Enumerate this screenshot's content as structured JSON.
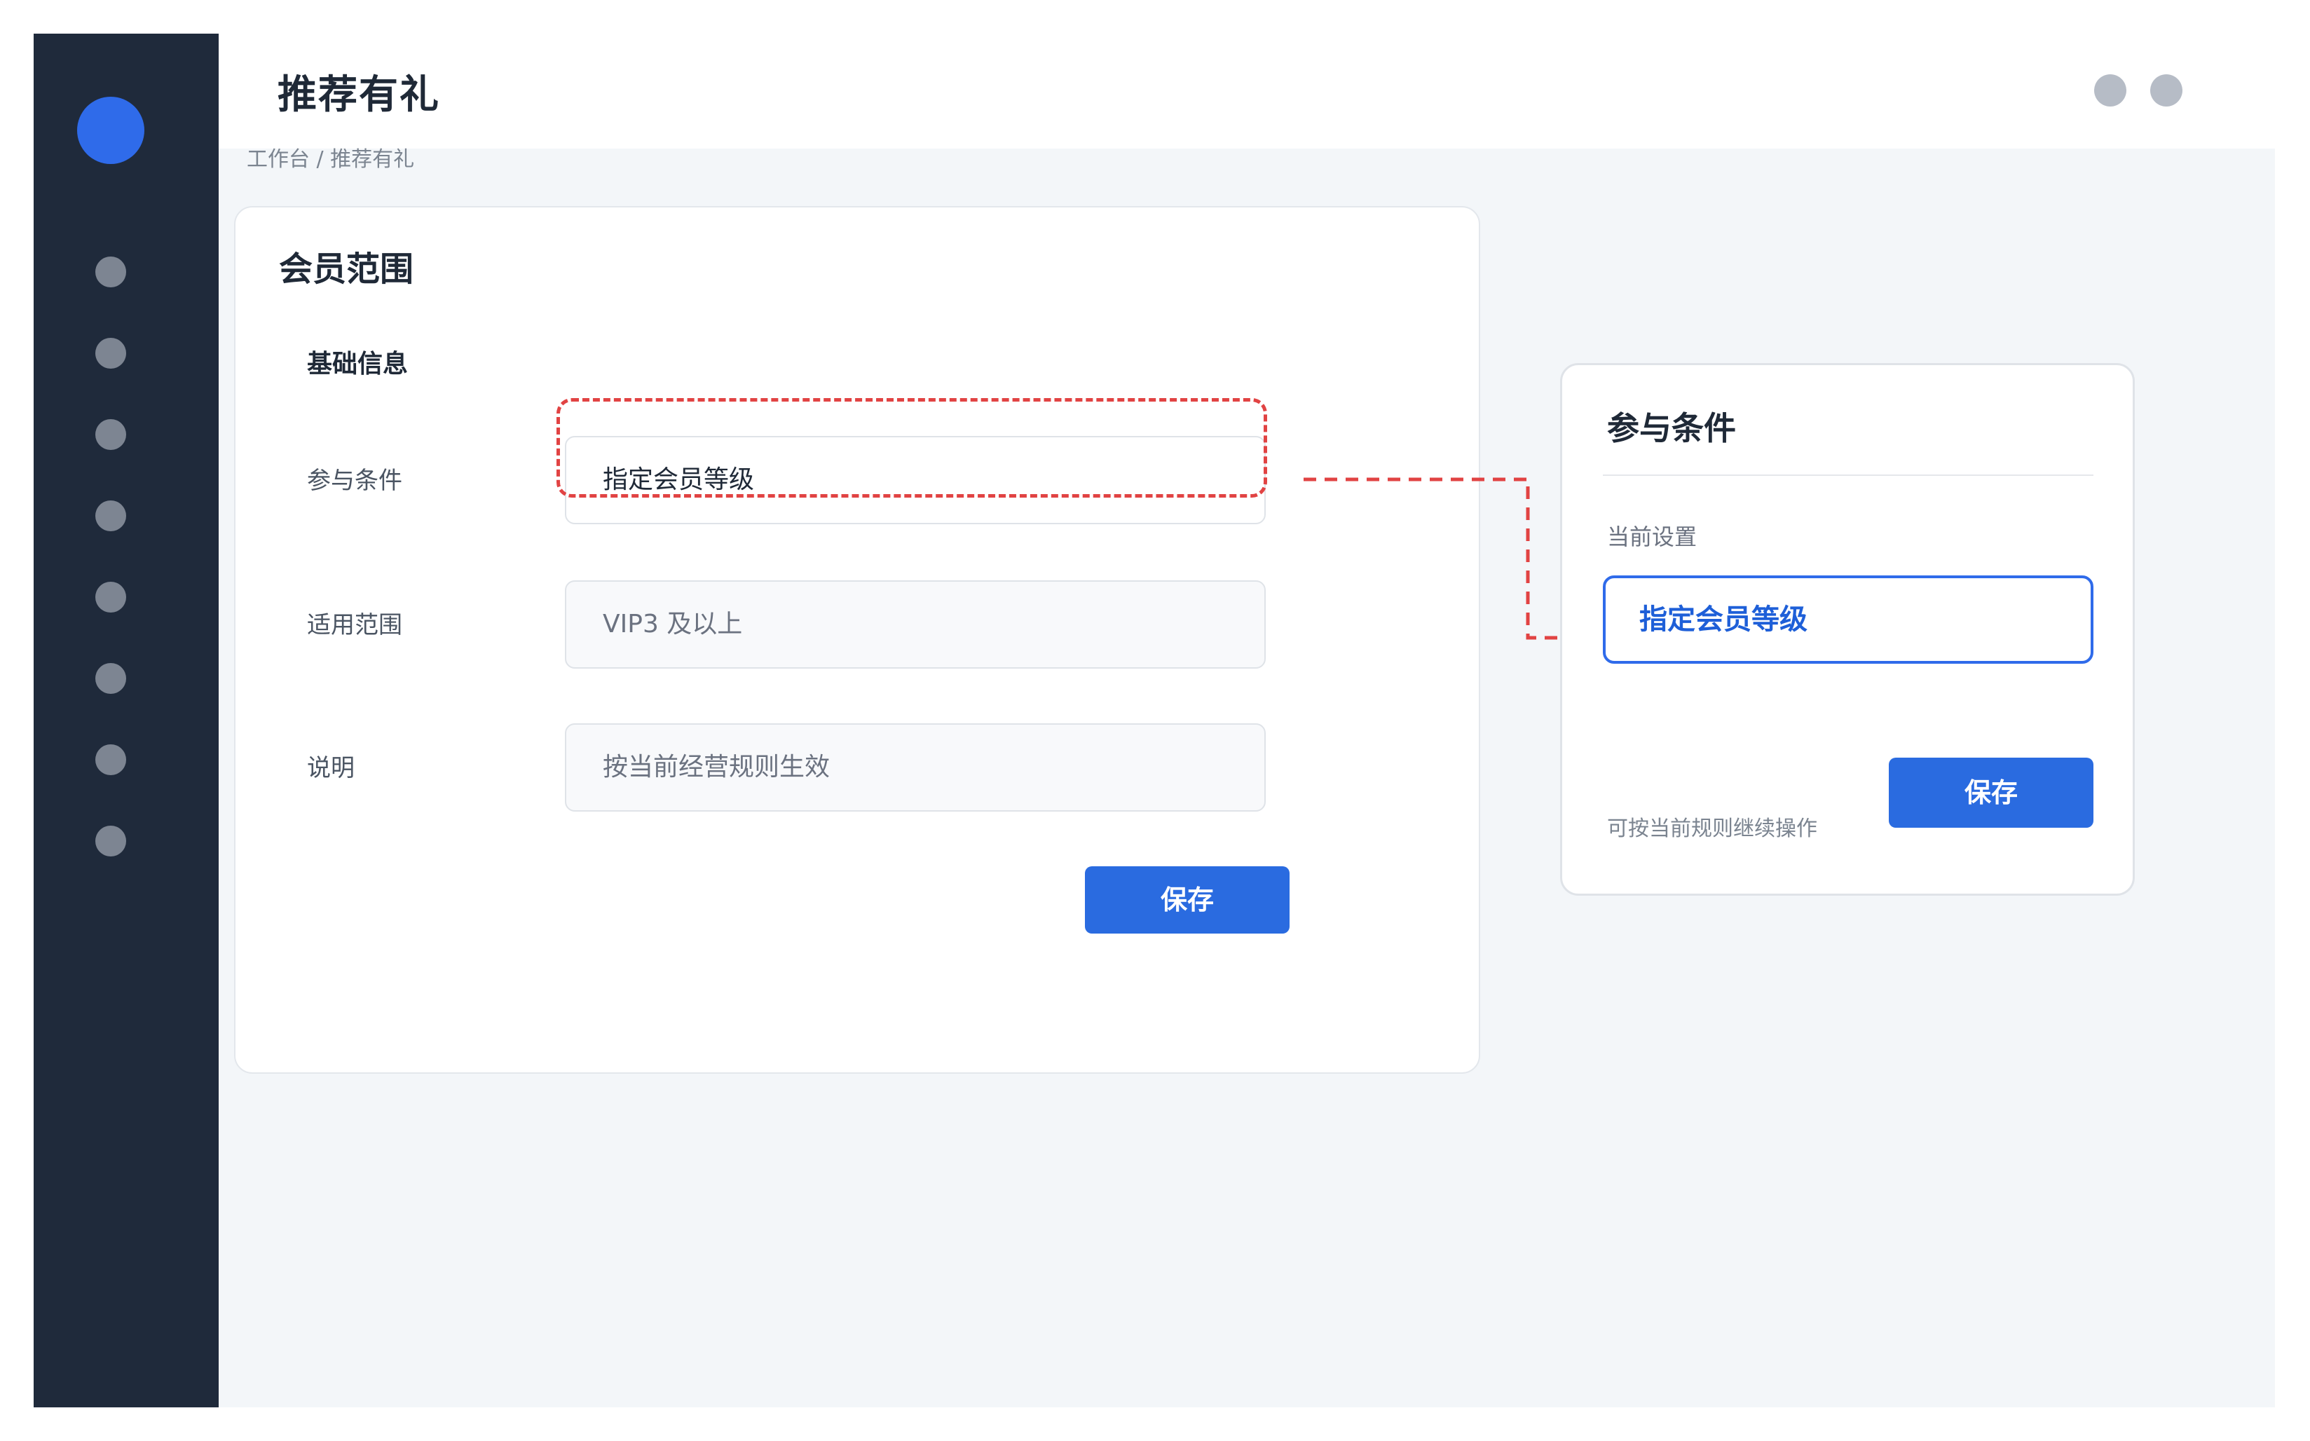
{
  "header": {
    "title": "推荐有礼"
  },
  "breadcrumb": "工作台 / 推荐有礼",
  "sidebar": {
    "logo_icon": "logo-icon",
    "nav_item_count": 8
  },
  "card": {
    "title": "会员范围",
    "section_title": "基础信息",
    "fields": [
      {
        "label": "参与条件",
        "value": "指定会员等级"
      },
      {
        "label": "适用范围",
        "value": "VIP3 及以上"
      },
      {
        "label": "说明",
        "value": "按当前经营规则生效"
      }
    ],
    "save_label": "保存"
  },
  "panel": {
    "title": "参与条件",
    "current_label": "当前设置",
    "current_value": "指定会员等级",
    "hint": "可按当前规则继续操作",
    "save_label": "保存"
  },
  "colors": {
    "sidebar_bg": "#1f2a3b",
    "accent": "#2a6be0",
    "highlight": "#e14343",
    "page_bg": "#f3f6f9"
  }
}
